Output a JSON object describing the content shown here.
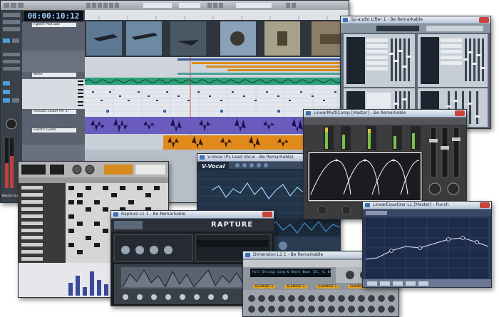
{
  "daw": {
    "timecode": "00:00:10:12",
    "track_names": [
      "Fighter Pilot.wav",
      "Noise",
      "Acoustic Guitar (Pri 1)",
      "Electric Guitar"
    ],
    "left_labels": [
      "Electric Guit"
    ]
  },
  "windows": {
    "sp_title": "Sp-audio Lifter 1 - Be Remarkable",
    "drum_title": "",
    "vocal_title": "V-Vocal (PL Lead Vocal - Be Remarkable)",
    "vocal_logo": "V-Vocal",
    "comp_title": "LinearMultiComp [Master] - Be Remarkable",
    "rapture_title": "Rapture L1 1 - Be Remarkable",
    "rapture_logo": "RAPTURE",
    "dimension_title": "Dimension L1 1 - Be Remarkable",
    "dimension_display": "Full Strings Long & Short Bows [21, 4, 84]",
    "eq_title": "LinearEqualizer L1 [Master] - Punch",
    "elements": [
      "ELEMENT 1",
      "ELEMENT 2",
      "ELEMENT 3",
      "ELEMENT 4"
    ]
  },
  "colors": {
    "audio_green": "#2aa07a",
    "audio_purple": "#4a3a9c",
    "audio_orange": "#e08a1c",
    "eq_curve": "#e6e6f0",
    "comp_curve": "#ffffff"
  }
}
